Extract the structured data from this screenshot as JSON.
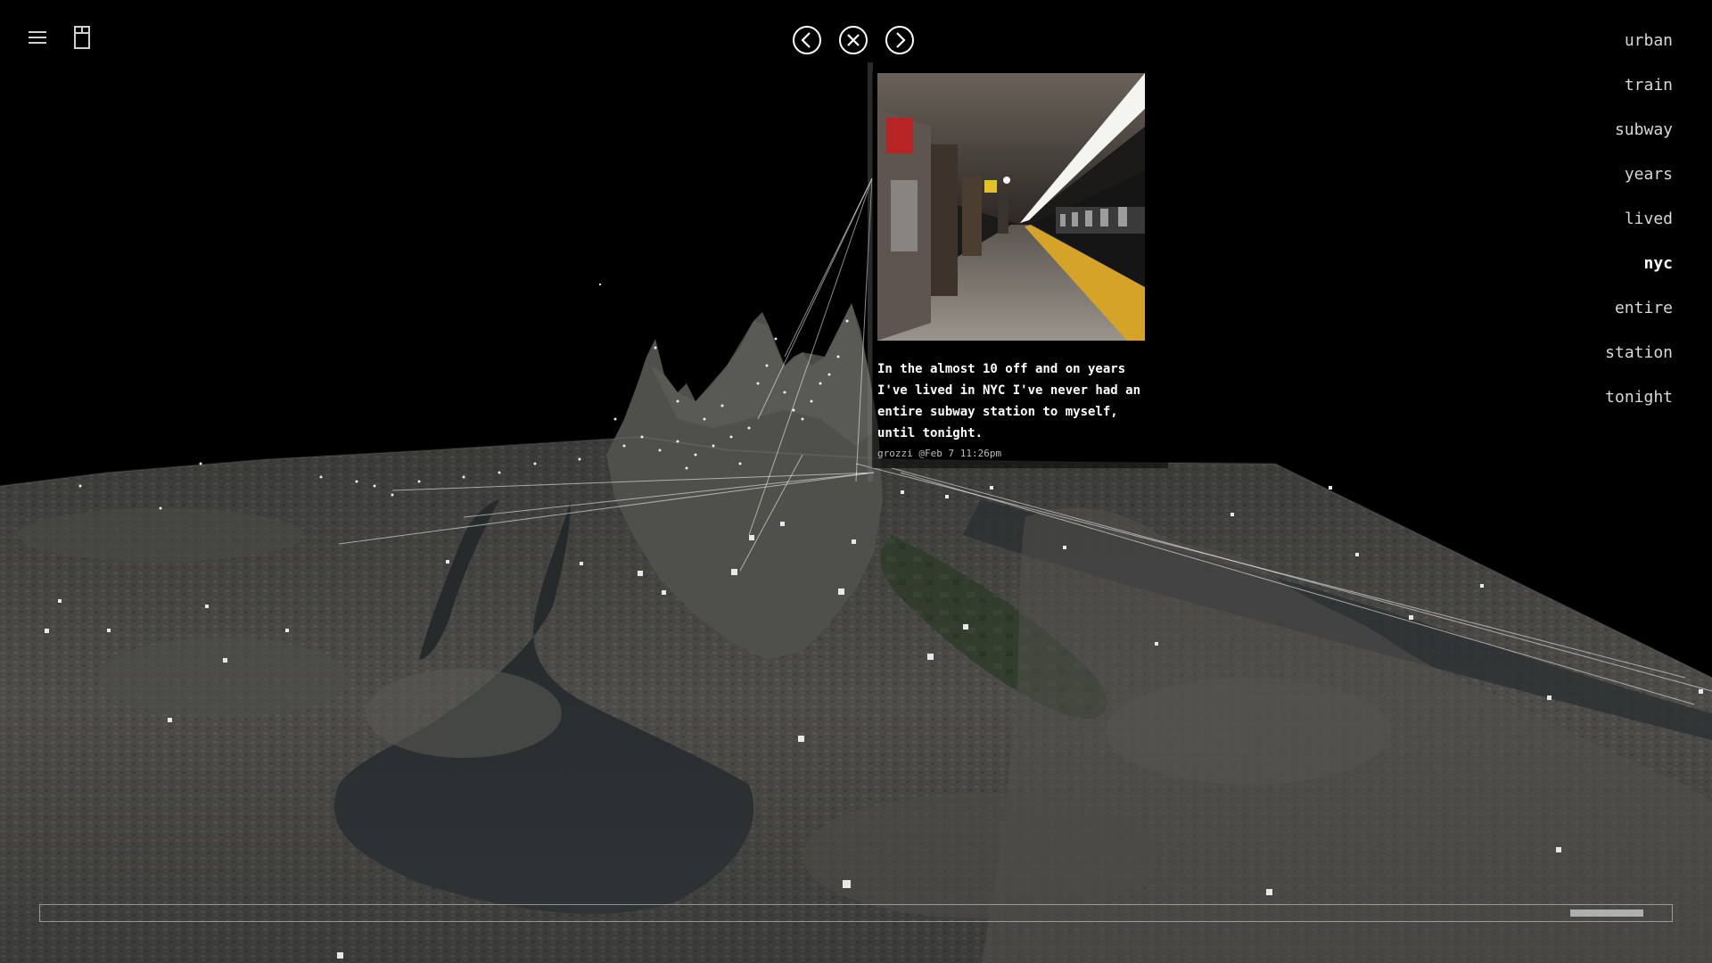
{
  "toolbar": {
    "menu_icon": "hamburger-icon",
    "bookmark_icon": "panel-icon"
  },
  "nav": {
    "prev_icon": "chevron-left-circle-icon",
    "close_icon": "close-circle-icon",
    "next_icon": "chevron-right-circle-icon"
  },
  "keywords": {
    "items": [
      "urban",
      "train",
      "subway",
      "years",
      "lived",
      "nyc",
      "entire",
      "station",
      "tonight"
    ],
    "active": "nyc"
  },
  "post": {
    "text": "In the almost 10 off and on years I've lived in NYC I've never had an entire subway station to myself, until tonight.",
    "meta": "grozzi @Feb 7 11:26pm",
    "image_icon": "subway-platform-photo"
  },
  "timeline": {
    "position": 0.96,
    "window": 0.045
  },
  "colors": {
    "background": "#000000",
    "text": "#ffffff",
    "terrain": "#4a4a47",
    "water": "#2a2e30"
  }
}
